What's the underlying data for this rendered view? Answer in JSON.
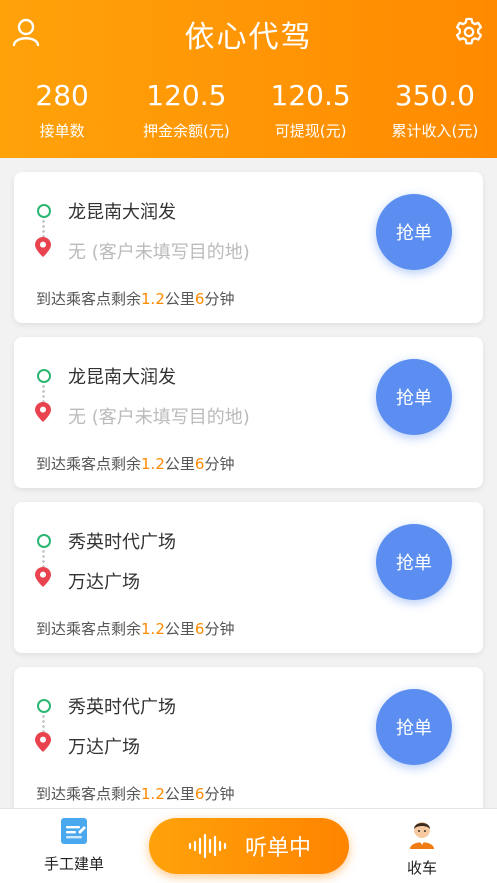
{
  "header": {
    "title": "依心代驾",
    "stats": [
      {
        "value": "280",
        "label": "接单数"
      },
      {
        "value": "120.5",
        "label": "押金余额(元)"
      },
      {
        "value": "120.5",
        "label": "可提现(元)"
      },
      {
        "value": "350.0",
        "label": "累计收入(元)"
      }
    ]
  },
  "orders": [
    {
      "from": "龙昆南大润发",
      "to": "无 (客户未填写目的地)",
      "dist_prefix": "到达乘客点剩余",
      "km": "1.2",
      "km_unit": "公里",
      "min": "6",
      "min_unit": "分钟",
      "button": "抢单"
    },
    {
      "from": "龙昆南大润发",
      "to": "无 (客户未填写目的地)",
      "dist_prefix": "到达乘客点剩余",
      "km": "1.2",
      "km_unit": "公里",
      "min": "6",
      "min_unit": "分钟",
      "button": "抢单"
    },
    {
      "from": "秀英时代广场",
      "to": "万达广场",
      "dist_prefix": "到达乘客点剩余",
      "km": "1.2",
      "km_unit": "公里",
      "min": "6",
      "min_unit": "分钟",
      "button": "抢单"
    },
    {
      "from": "秀英时代广场",
      "to": "万达广场",
      "dist_prefix": "到达乘客点剩余",
      "km": "1.2",
      "km_unit": "公里",
      "min": "6",
      "min_unit": "分钟",
      "button": "抢单"
    }
  ],
  "tabbar": {
    "manual_label": "手工建单",
    "listen_label": "听单中",
    "close_label": "收车"
  },
  "colors": {
    "accent": "#ff8a00",
    "button_blue": "#5b8ef0",
    "origin_green": "#2bb673",
    "destination_red": "#e8434e"
  },
  "icons": {
    "profile": "user-icon",
    "settings": "gear-icon",
    "manual": "edit-document-icon",
    "listen": "soundwave-icon",
    "close": "driver-avatar-icon"
  }
}
